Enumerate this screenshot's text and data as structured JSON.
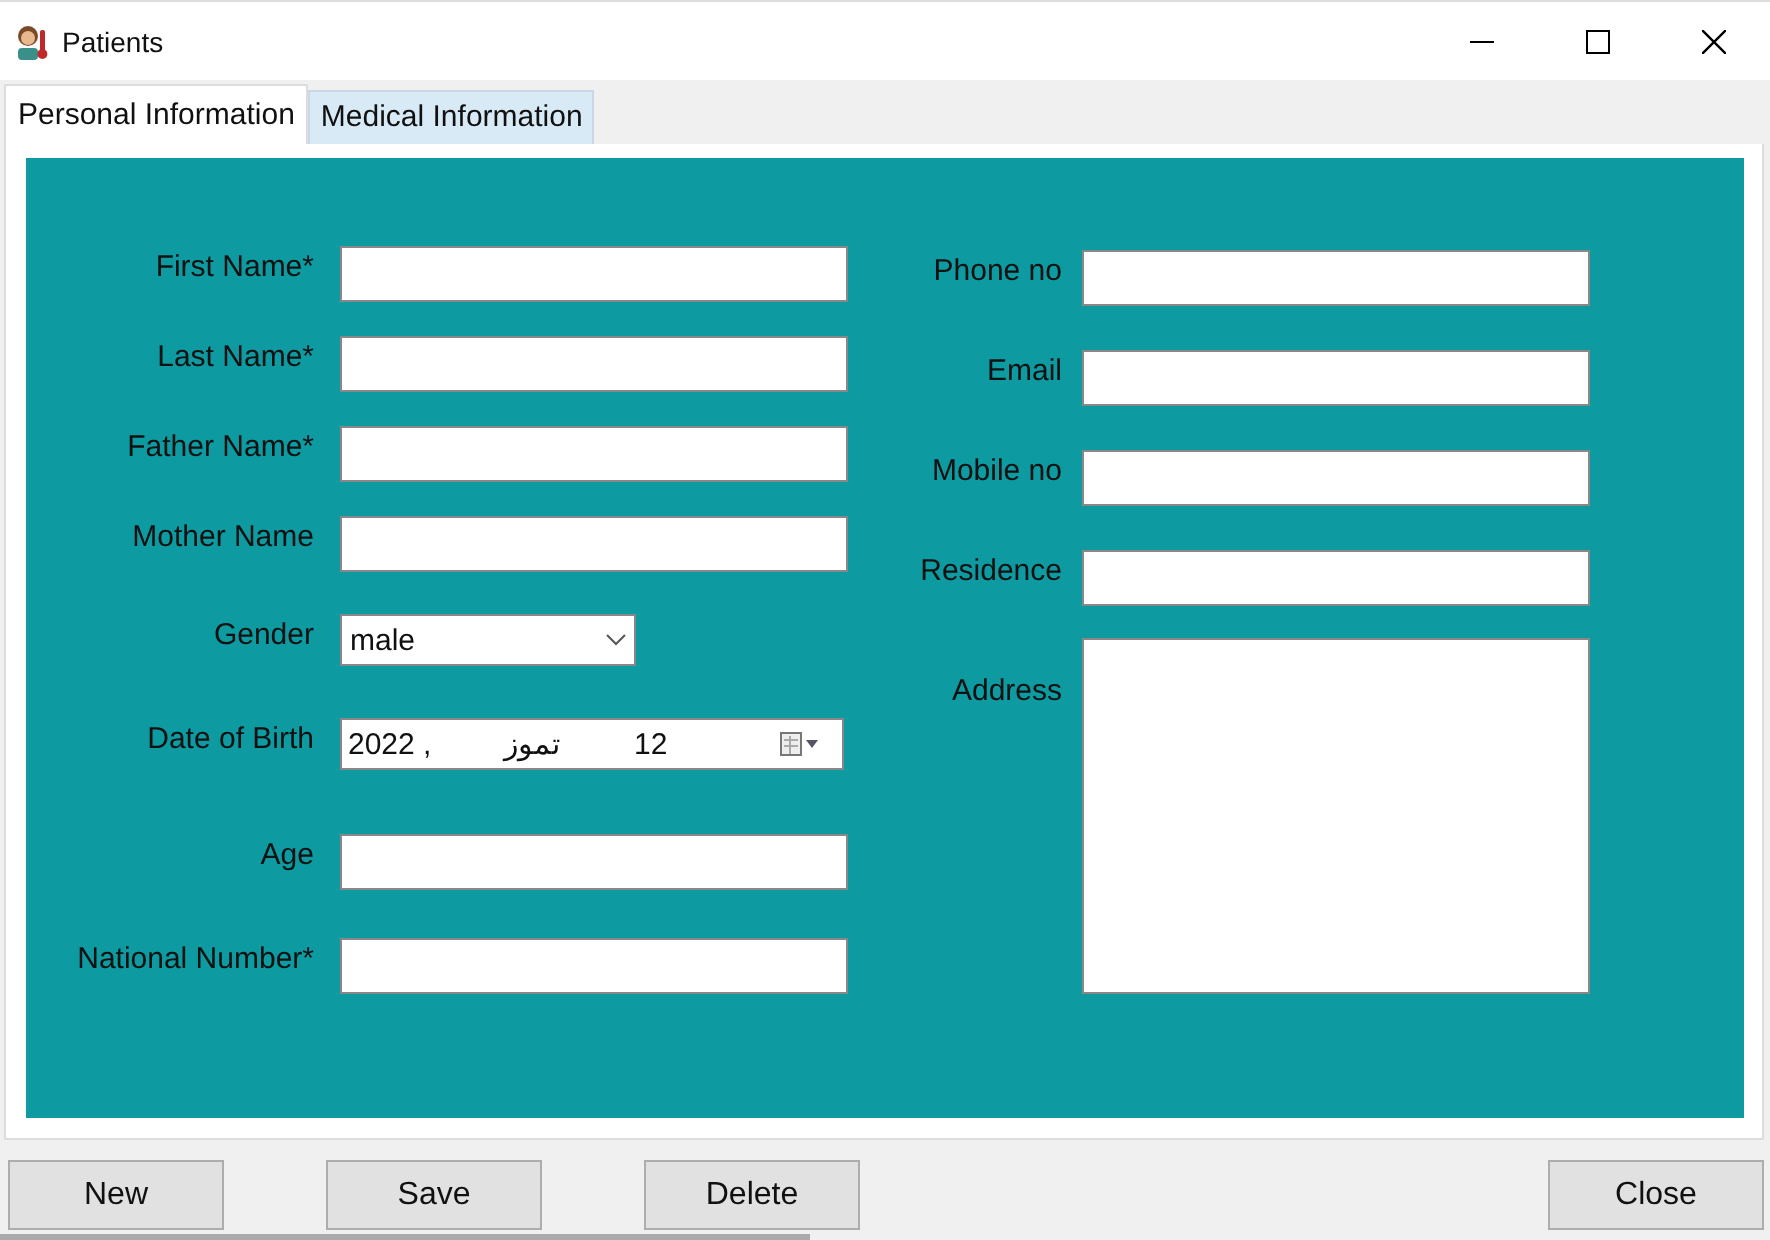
{
  "window": {
    "title": "Patients"
  },
  "tabs": [
    {
      "label": "Personal Information",
      "selected": true
    },
    {
      "label": "Medical Information",
      "selected": false
    }
  ],
  "left_fields": [
    {
      "label": "First Name*",
      "kind": "text"
    },
    {
      "label": "Last Name*",
      "kind": "text"
    },
    {
      "label": "Father Name*",
      "kind": "text"
    },
    {
      "label": "Mother Name",
      "kind": "text"
    },
    {
      "label": "Gender",
      "kind": "combo",
      "value": "male"
    },
    {
      "label": "Date of Birth",
      "kind": "date",
      "parts": [
        "2022 ,",
        "تموز",
        "12"
      ]
    },
    {
      "label": "Age",
      "kind": "text"
    },
    {
      "label": "National Number*",
      "kind": "text"
    }
  ],
  "right_fields": [
    {
      "label": "Phone no",
      "kind": "text"
    },
    {
      "label": "Email",
      "kind": "text"
    },
    {
      "label": "Mobile no",
      "kind": "text"
    },
    {
      "label": "Residence",
      "kind": "text"
    },
    {
      "label": "Address",
      "kind": "textarea"
    }
  ],
  "buttons": [
    {
      "label": "New",
      "kind": "left"
    },
    {
      "label": "Save",
      "kind": "left"
    },
    {
      "label": "Delete",
      "kind": "left"
    },
    {
      "label": "Close",
      "kind": "right"
    }
  ]
}
